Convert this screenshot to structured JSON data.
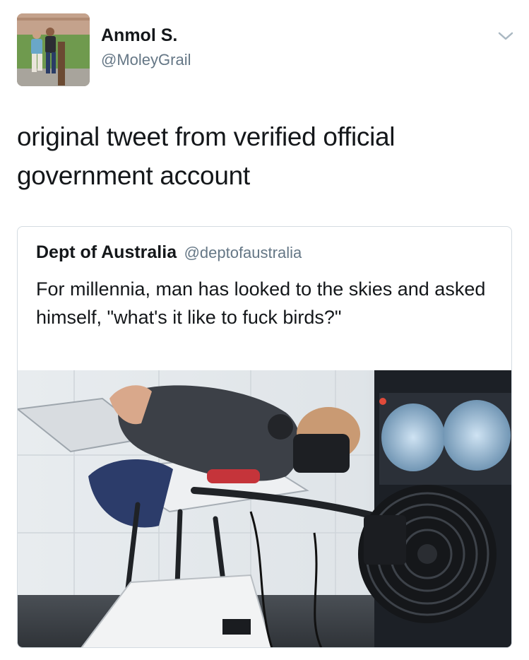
{
  "tweet": {
    "author": {
      "display_name": "Anmol S.",
      "handle": "@MoleyGrail",
      "avatar_icon": "profile-photo"
    },
    "menu_icon": "chevron-down-icon",
    "text": "original tweet from verified official government account"
  },
  "quoted_tweet": {
    "display_name": "Dept of Australia",
    "handle": "@deptofaustralia",
    "text": "For millennia, man has looked to the skies and asked himself, \"what's it like to fuck birds?\"",
    "media": {
      "type": "photo"
    }
  },
  "colors": {
    "text_primary": "#14171a",
    "text_secondary": "#657786",
    "card_border": "#d4dbe1",
    "chevron": "#aab8c2"
  }
}
